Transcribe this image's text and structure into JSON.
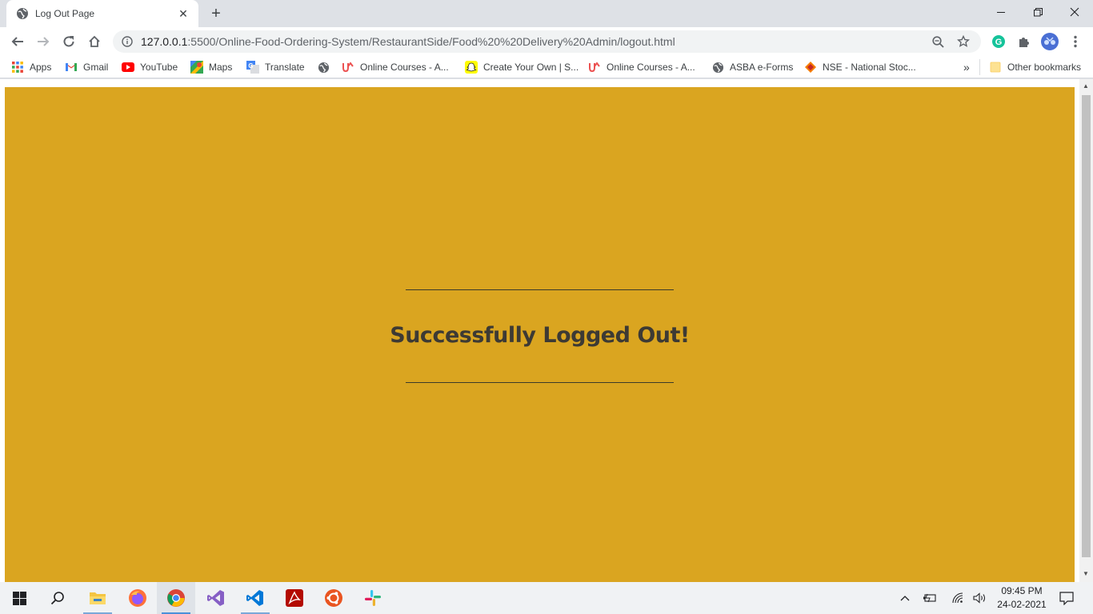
{
  "browser": {
    "tab": {
      "title": "Log Out Page",
      "close": "✕"
    },
    "new_tab": "+",
    "window_controls": {
      "minimize": "—",
      "restore": "❐",
      "close": "✕"
    },
    "address": {
      "host": "127.0.0.1",
      "path": ":5500/Online-Food-Ordering-System/RestaurantSide/Food%20%20Delivery%20Admin/logout.html"
    },
    "bookmarks": [
      {
        "label": "Apps",
        "icon": "apps-grid-icon"
      },
      {
        "label": "Gmail",
        "icon": "gmail-icon"
      },
      {
        "label": "YouTube",
        "icon": "youtube-icon"
      },
      {
        "label": "Maps",
        "icon": "maps-icon"
      },
      {
        "label": "Translate",
        "icon": "translate-icon"
      },
      {
        "label": "",
        "icon": "globe-icon"
      },
      {
        "label": "Online Courses - A...",
        "icon": "udemy-icon"
      },
      {
        "label": "Create Your Own | S...",
        "icon": "snapchat-icon"
      },
      {
        "label": "Online Courses - A...",
        "icon": "udemy-icon"
      },
      {
        "label": "ASBA e-Forms",
        "icon": "globe-icon"
      },
      {
        "label": "NSE - National Stoc...",
        "icon": "nse-icon"
      }
    ],
    "bookmarks_more": "»",
    "other_bookmarks": "Other bookmarks"
  },
  "page": {
    "heading": "Successfully Logged Out!",
    "background_color": "#daa520"
  },
  "taskbar": {
    "apps": [
      "start-icon",
      "search-icon",
      "file-explorer-icon",
      "firefox-icon",
      "chrome-icon",
      "visual-studio-icon",
      "vscode-icon",
      "acrobat-icon",
      "ubuntu-icon",
      "slack-icon"
    ],
    "time": "09:45 PM",
    "date": "24-02-2021"
  }
}
